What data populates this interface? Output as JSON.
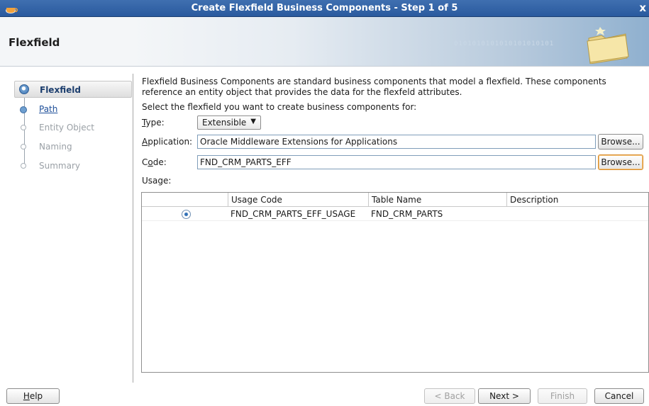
{
  "window": {
    "title": "Create Flexfield Business Components - Step 1 of 5",
    "close_glyph": "x"
  },
  "header": {
    "page_title": "Flexfield",
    "decoration_text": "0101010101010101010101"
  },
  "nav": {
    "items": [
      {
        "label": "Flexfield",
        "state": "active"
      },
      {
        "label": "Path",
        "state": "link"
      },
      {
        "label": "Entity Object",
        "state": "disabled"
      },
      {
        "label": "Naming",
        "state": "disabled"
      },
      {
        "label": "Summary",
        "state": "disabled"
      }
    ]
  },
  "main": {
    "description_line1": "Flexfield Business Components are standard business components that model a flexfield. These components",
    "description_line2": "reference an entity object that provides the data for the flexfeld attributes.",
    "select_prompt": "Select the flexfield you want to create business components for:",
    "type": {
      "label_first": "T",
      "label_rest": "ype:",
      "value": "Extensible"
    },
    "application": {
      "label_first": "A",
      "label_rest": "pplication:",
      "value": "Oracle Middleware Extensions for Applications",
      "browse_label": "Browse..."
    },
    "code": {
      "label_pre": "C",
      "label_u": "o",
      "label_rest": "de:",
      "value": "FND_CRM_PARTS_EFF",
      "browse_label": "Browse..."
    },
    "usage_label": "Usage:",
    "usage_table": {
      "columns": [
        "",
        "Usage Code",
        "Table Name",
        "Description"
      ],
      "rows": [
        {
          "selected": true,
          "usage_code": "FND_CRM_PARTS_EFF_USAGE",
          "table_name": "FND_CRM_PARTS",
          "description": ""
        }
      ]
    }
  },
  "footer": {
    "help": "Help",
    "back": "< Back",
    "next": "Next >",
    "finish": "Finish",
    "cancel": "Cancel"
  },
  "colors": {
    "title_bar": "#2f5fa3",
    "accent_focus": "#d78b29",
    "link": "#1e4f99"
  },
  "icons": {
    "app": "coffee-cup-icon",
    "header": "folder-icon",
    "radio": "radio-selected-icon"
  }
}
